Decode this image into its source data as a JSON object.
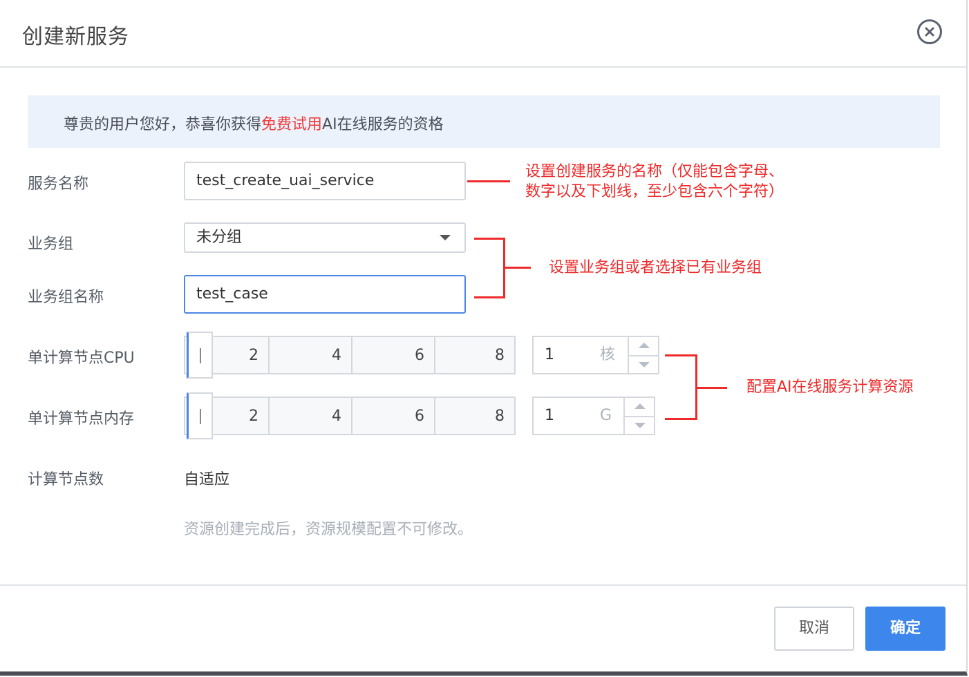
{
  "dialog": {
    "title": "创建新服务",
    "notice": {
      "prefix": "尊贵的用户您好，恭喜你获得",
      "highlight": "免费试用",
      "suffix": "AI在线服务的资格"
    }
  },
  "form": {
    "service_name": {
      "label": "服务名称",
      "value": "test_create_uai_service"
    },
    "business_group": {
      "label": "业务组",
      "selected": "未分组"
    },
    "business_group_name": {
      "label": "业务组名称",
      "value": "test_case"
    },
    "cpu": {
      "label": "单计算节点CPU",
      "ticks": [
        "2",
        "4",
        "6",
        "8"
      ],
      "level": 1,
      "value": "1",
      "unit": "核"
    },
    "memory": {
      "label": "单计算节点内存",
      "ticks": [
        "2",
        "4",
        "6",
        "8"
      ],
      "level": 1,
      "value": "1",
      "unit": "G"
    },
    "node_count": {
      "label": "计算节点数",
      "value": "自适应"
    },
    "hint": "资源创建完成后，资源规模配置不可修改。"
  },
  "annotations": {
    "name_rule_line1": "设置创建服务的名称（仅能包含字母、",
    "name_rule_line2": "数字以及下划线，至少包含六个字符）",
    "group_note": "设置业务组或者选择已有业务组",
    "resource_note": "配置AI在线服务计算资源"
  },
  "footer": {
    "cancel_label": "取消",
    "confirm_label": "确定"
  },
  "colors": {
    "primary": "#3c86ec",
    "highlight": "#ee3b3b",
    "annotation": "#ee2a2a",
    "notice_bg": "#ecf2fb"
  }
}
